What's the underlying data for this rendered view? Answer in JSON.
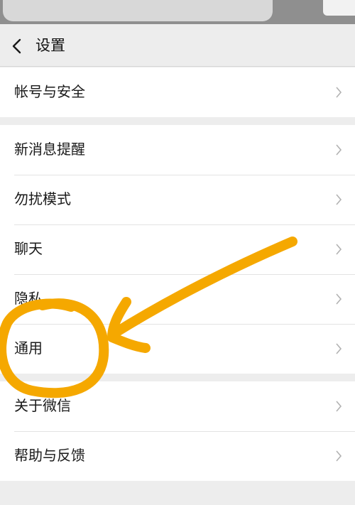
{
  "header": {
    "title": "设置",
    "back_icon": "chevron-left-icon"
  },
  "groups": [
    {
      "items": [
        {
          "label": "帐号与安全"
        }
      ]
    },
    {
      "items": [
        {
          "label": "新消息提醒"
        },
        {
          "label": "勿扰模式"
        },
        {
          "label": "聊天"
        },
        {
          "label": "隐私"
        },
        {
          "label": "通用"
        }
      ]
    },
    {
      "items": [
        {
          "label": "关于微信"
        },
        {
          "label": "帮助与反馈"
        }
      ]
    }
  ],
  "colors": {
    "background": "#ededed",
    "row_background": "#ffffff",
    "annotation": "#f5a800",
    "chevron": "#b2b2b2"
  }
}
